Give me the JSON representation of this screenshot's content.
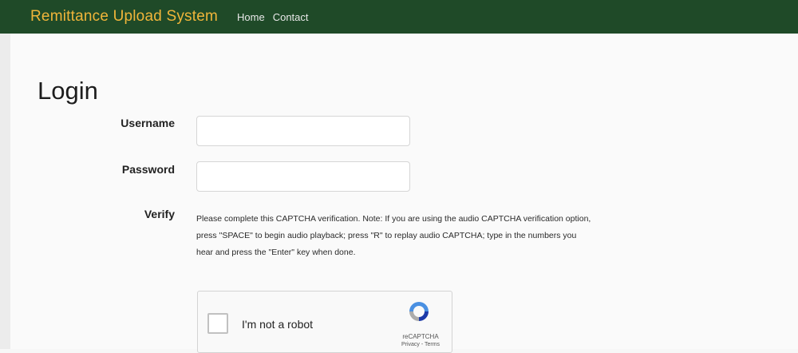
{
  "navbar": {
    "brand": "Remittance Upload System",
    "links": [
      "Home",
      "Contact"
    ]
  },
  "page": {
    "title": "Login"
  },
  "form": {
    "username_label": "Username",
    "username_value": "",
    "password_label": "Password",
    "password_value": "",
    "verify_label": "Verify",
    "captcha_instructions": "Please complete this CAPTCHA verification. Note: If you are using the audio CAPTCHA verification option, press \"SPACE\" to begin audio playback; press \"R\" to replay audio CAPTCHA; type in the numbers you hear and press the \"Enter\" key when done."
  },
  "recaptcha": {
    "checkbox_label": "I'm not a robot",
    "brand": "reCAPTCHA",
    "links": "Privacy - Terms",
    "icon": "recaptcha-logo-icon"
  },
  "colors": {
    "navbar_bg": "#1f4a28",
    "brand_color": "#f0b53a"
  }
}
